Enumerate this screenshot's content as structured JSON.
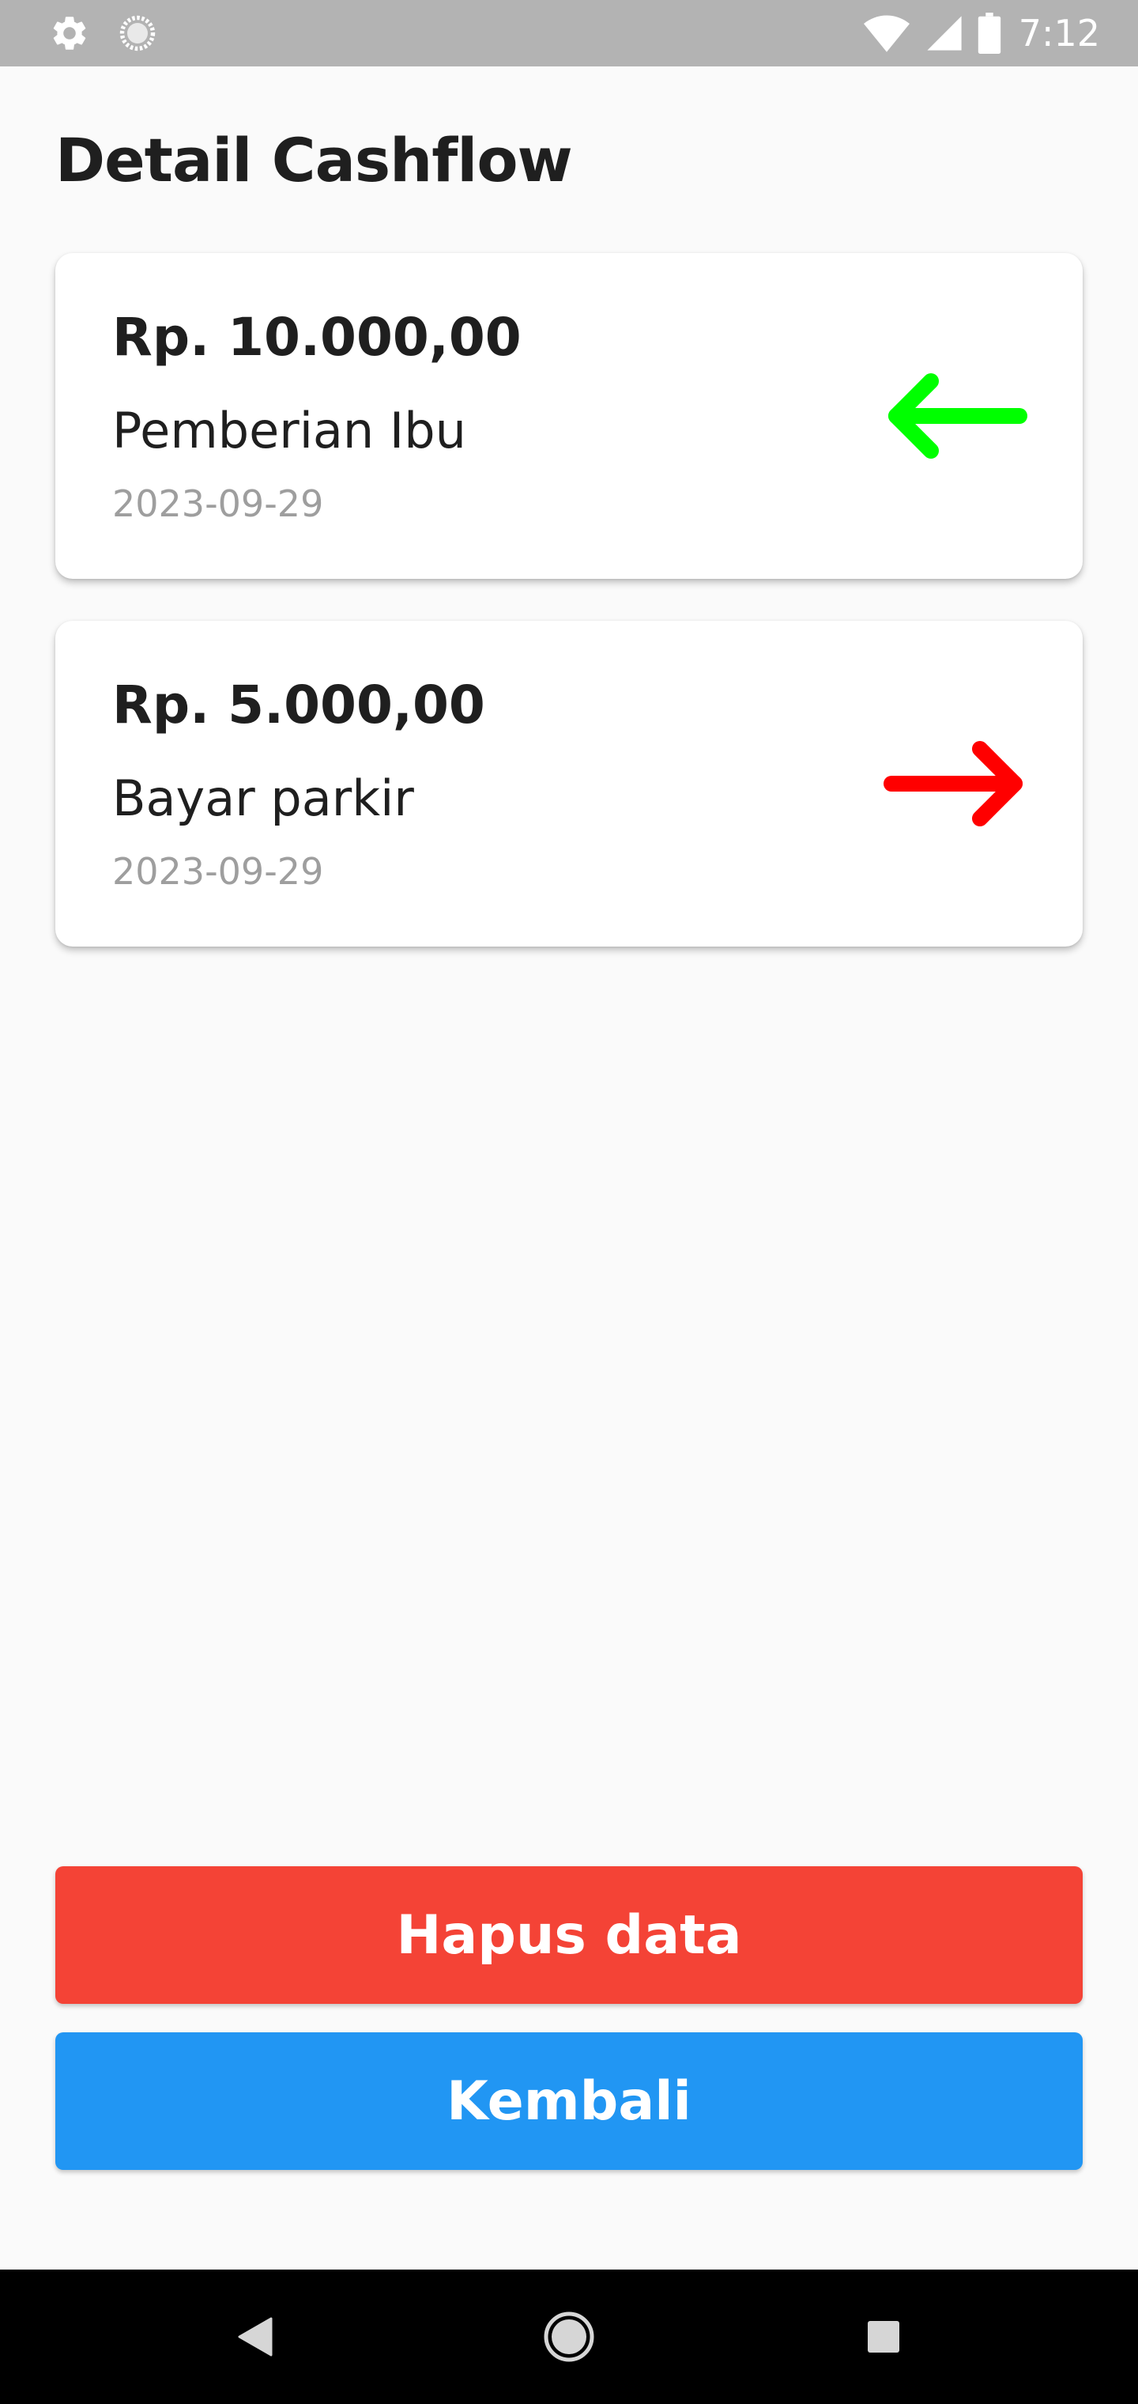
{
  "status_bar": {
    "time": "7:12",
    "icons": [
      "settings-icon",
      "loading-icon",
      "wifi-icon",
      "signal-icon",
      "battery-icon"
    ]
  },
  "page": {
    "title": "Detail Cashflow"
  },
  "transactions": [
    {
      "amount": "Rp. 10.000,00",
      "description": "Pemberian Ibu",
      "date": "2023-09-29",
      "direction": "income",
      "icon": "arrow-left-icon",
      "color": "#00ff00"
    },
    {
      "amount": "Rp. 5.000,00",
      "description": "Bayar parkir",
      "date": "2023-09-29",
      "direction": "expense",
      "icon": "arrow-right-icon",
      "color": "#ff0000"
    }
  ],
  "actions": {
    "delete_label": "Hapus data",
    "delete_color": "#f44336",
    "back_label": "Kembali",
    "back_color": "#2196f3"
  },
  "navigation": {
    "icons": [
      "back-triangle-icon",
      "home-circle-icon",
      "recents-square-icon"
    ]
  }
}
